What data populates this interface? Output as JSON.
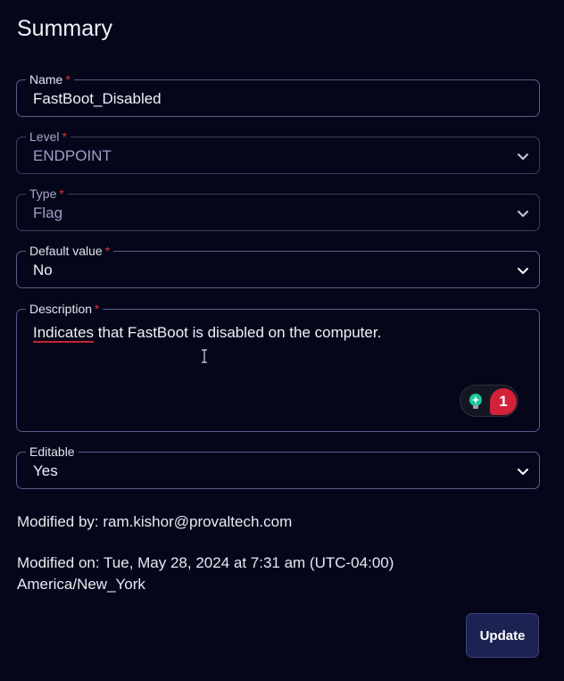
{
  "page": {
    "title": "Summary"
  },
  "fields": {
    "name": {
      "label": "Name",
      "required_mark": "*",
      "value": "FastBoot_Disabled"
    },
    "level": {
      "label": "Level",
      "required_mark": "*",
      "value": "ENDPOINT"
    },
    "type": {
      "label": "Type",
      "required_mark": "*",
      "value": "Flag"
    },
    "default_value": {
      "label": "Default value",
      "required_mark": "*",
      "value": "No"
    },
    "description": {
      "label": "Description",
      "required_mark": "*",
      "value_first_word": "Indicates",
      "value_rest": " that FastBoot is disabled on the computer.",
      "issue_count": "1"
    },
    "editable": {
      "label": "Editable",
      "value": "Yes"
    }
  },
  "meta": {
    "modified_by": "Modified by: ram.kishor@provaltech.com",
    "modified_on_line1": "Modified on: Tue, May 28, 2024 at 7:31 am (UTC-04:00)",
    "modified_on_line2": "America/New_York"
  },
  "actions": {
    "update_label": "Update"
  },
  "icons": {
    "chevron": "chevron-down-icon",
    "grammar": "lightbulb-icon",
    "cursor": "text-cursor-icon"
  },
  "colors": {
    "background": "#05061a",
    "required": "#e0323f",
    "button": "#1c2251",
    "badge": "#d4213a"
  }
}
